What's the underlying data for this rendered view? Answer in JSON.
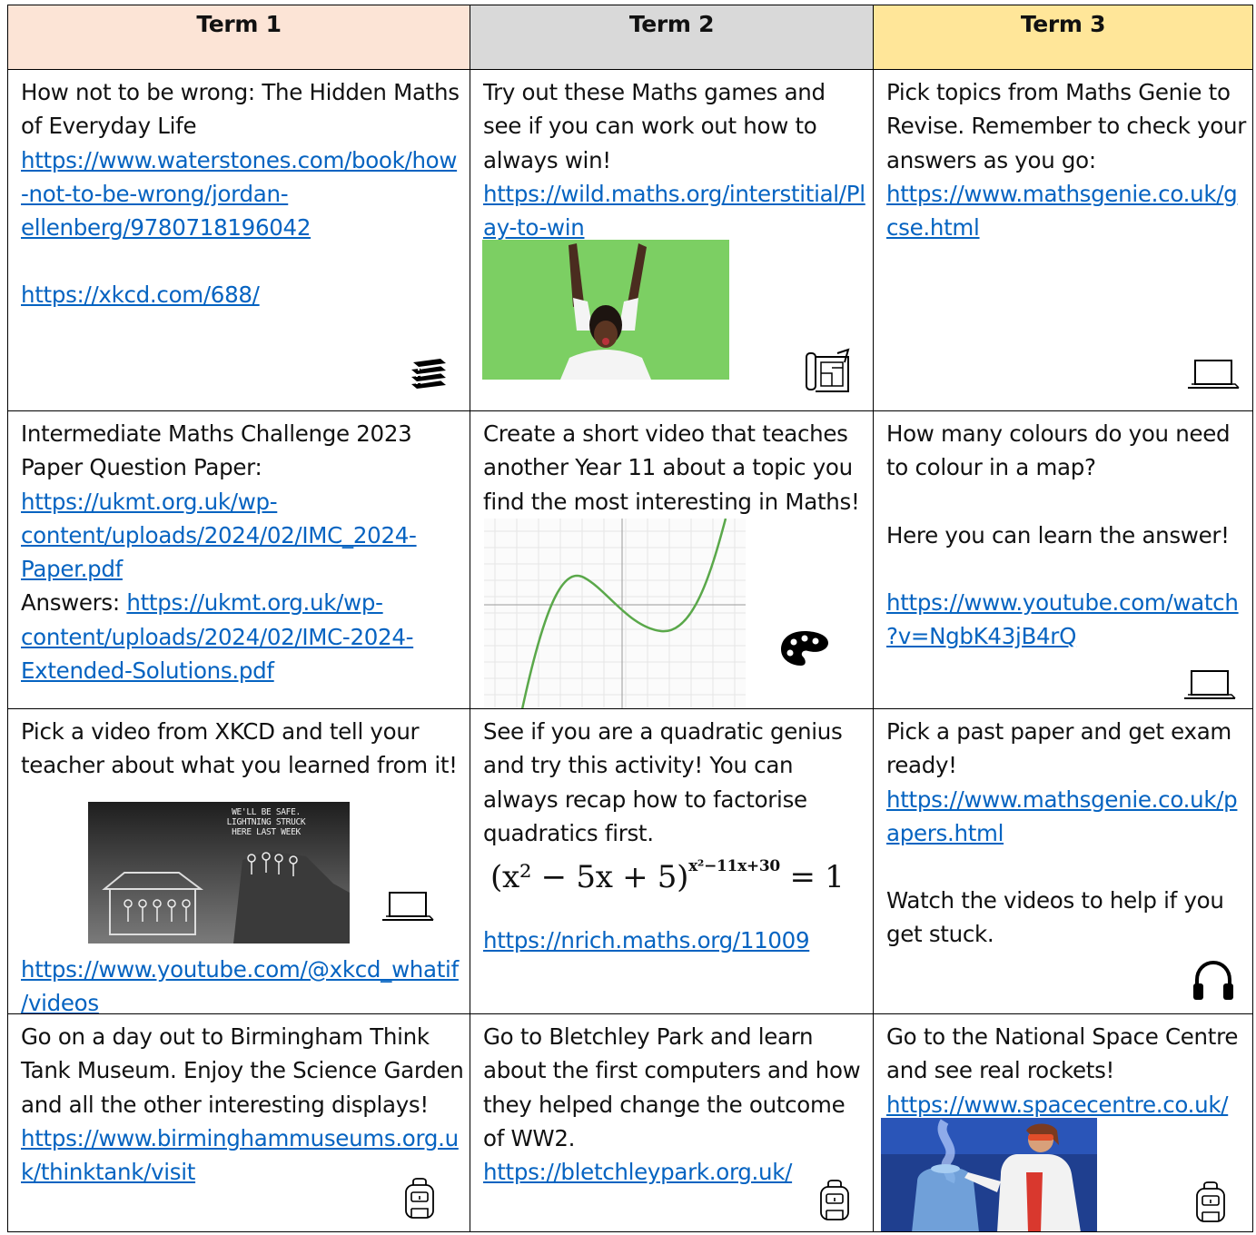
{
  "colors": {
    "term1": "#fce4d6",
    "term2": "#d9d9d9",
    "term3": "#ffe699",
    "link": "#0563c1"
  },
  "headers": [
    "Term 1",
    "Term 2",
    "Term 3"
  ],
  "r1": {
    "c1": {
      "text": "How not to be wrong: The Hidden Maths of Everyday Life",
      "link1": "https://www.waterstones.com/book/how-not-to-be-wrong/jordan-ellenberg/9780718196042",
      "link2": "https://xkcd.com/688/",
      "icon": "books-icon"
    },
    "c2": {
      "text": "Try out these Maths games and see if you can work out how to always win!",
      "link": "https://wild.maths.org/interstitial/Play-to-win",
      "icon": "blueprint-icon"
    },
    "c3": {
      "text": "Pick topics from Maths Genie to Revise. Remember to check your answers as you go:",
      "link": "https://www.mathsgenie.co.uk/gcse.html",
      "icon": "laptop-icon"
    }
  },
  "r2": {
    "c1": {
      "text": "Intermediate Maths Challenge 2023 Paper Question Paper:",
      "link1": "https://ukmt.org.uk/wp-content/uploads/2024/02/IMC_2024-Paper.pdf",
      "answers_label": "Answers:",
      "link2": "https://ukmt.org.uk/wp-content/uploads/2024/02/IMC-2024-Extended-Solutions.pdf"
    },
    "c2": {
      "text": "Create a short video that teaches another Year 11 about a topic you find the most interesting in Maths!",
      "icon": "palette-icon"
    },
    "c3": {
      "text1": "How many colours do you need to colour in a map?",
      "text2": "Here you can learn the answer!",
      "link": "https://www.youtube.com/watch?v=NgbK43jB4rQ",
      "icon": "laptop-icon"
    }
  },
  "r3": {
    "c1": {
      "text": "Pick a video from XKCD and tell your teacher about what you learned from it!",
      "comic_text": [
        "WE'LL BE SAFE.",
        "LIGHTNING STRUCK",
        "HERE LAST WEEK"
      ],
      "link": "https://www.youtube.com/@xkcd_whatif/videos",
      "icon": "laptop-icon"
    },
    "c2": {
      "text": "See if you are a quadratic genius and try this activity! You can always recap how to factorise quadratics first.",
      "eq_base": "(x² − 5x + 5)",
      "eq_exp": "x²−11x+30",
      "eq_rhs": "= 1",
      "link": "https://nrich.maths.org/11009"
    },
    "c3": {
      "text1": "Pick a past paper and get exam ready!",
      "link": "https://www.mathsgenie.co.uk/papers.html",
      "text2": "Watch the videos to help if you get stuck.",
      "icon": "headphones-icon"
    }
  },
  "r4": {
    "c1": {
      "text": "Go on a day out to Birmingham Think Tank Museum. Enjoy the Science Garden and all the other interesting displays!",
      "link": "https://www.birminghammuseums.org.uk/thinktank/visit",
      "icon": "backpack-icon"
    },
    "c2": {
      "text": "Go to Bletchley Park and learn about the first computers and how they helped change the outcome of WW2.",
      "link": "https://bletchleypark.org.uk/",
      "icon": "backpack-icon"
    },
    "c3": {
      "text": "Go to the National Space Centre and see real rockets!",
      "link": "https://www.spacecentre.co.uk/",
      "icon": "backpack-icon"
    }
  }
}
